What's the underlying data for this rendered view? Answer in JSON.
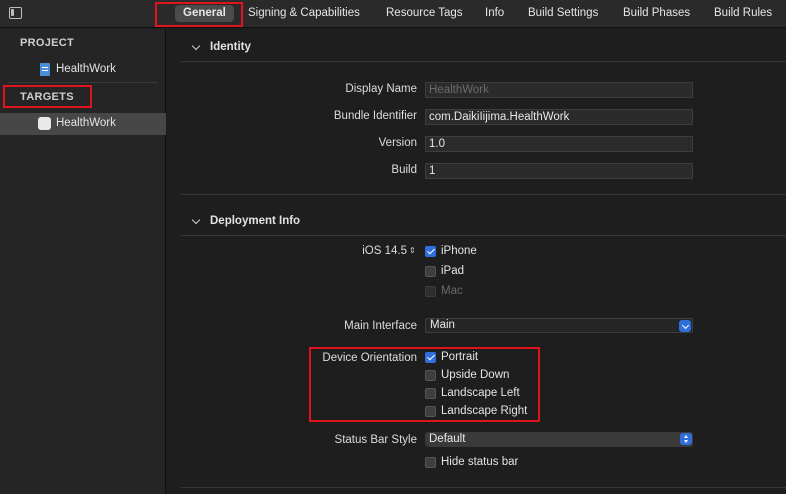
{
  "tabs": [
    {
      "label": "General",
      "active": true
    },
    {
      "label": "Signing & Capabilities"
    },
    {
      "label": "Resource Tags"
    },
    {
      "label": "Info"
    },
    {
      "label": "Build Settings"
    },
    {
      "label": "Build Phases"
    },
    {
      "label": "Build Rules"
    }
  ],
  "sidebar": {
    "project_header": "PROJECT",
    "project_item": "HealthWork",
    "targets_header": "TARGETS",
    "target_item": "HealthWork"
  },
  "identity": {
    "title": "Identity",
    "display_name_label": "Display Name",
    "display_name_placeholder": "HealthWork",
    "bundle_id_label": "Bundle Identifier",
    "bundle_id_value": "com.DaikiIijima.HealthWork",
    "version_label": "Version",
    "version_value": "1.0",
    "build_label": "Build",
    "build_value": "1"
  },
  "deployment": {
    "title": "Deployment Info",
    "ios_version": "iOS 14.5",
    "iphone_label": "iPhone",
    "iphone_checked": true,
    "ipad_label": "iPad",
    "ipad_checked": false,
    "mac_label": "Mac",
    "mac_checked": false,
    "main_interface_label": "Main Interface",
    "main_interface_value": "Main",
    "device_orientation_label": "Device Orientation",
    "orientations": [
      {
        "label": "Portrait",
        "checked": true
      },
      {
        "label": "Upside Down",
        "checked": false
      },
      {
        "label": "Landscape Left",
        "checked": false
      },
      {
        "label": "Landscape Right",
        "checked": false
      }
    ],
    "status_bar_style_label": "Status Bar Style",
    "status_bar_style_value": "Default",
    "hide_status_bar_label": "Hide status bar",
    "hide_status_bar_checked": false
  },
  "colors": {
    "accent": "#2f6fdc",
    "highlight": "#e0141e"
  }
}
